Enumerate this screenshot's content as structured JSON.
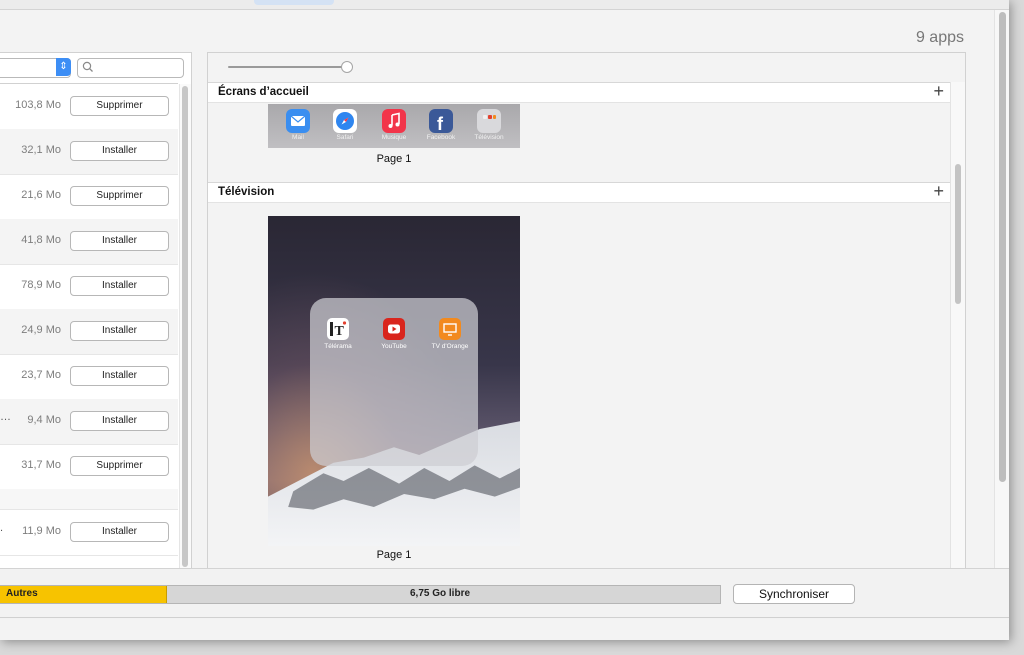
{
  "header": {
    "app_count": "9 apps"
  },
  "search": {
    "placeholder": ""
  },
  "apps_list": [
    {
      "size": "103,8 Mo",
      "action": "Supprimer",
      "prefix": ""
    },
    {
      "size": "32,1 Mo",
      "action": "Installer",
      "prefix": ""
    },
    {
      "size": "21,6 Mo",
      "action": "Supprimer",
      "prefix": ""
    },
    {
      "size": "41,8 Mo",
      "action": "Installer",
      "prefix": ""
    },
    {
      "size": "78,9 Mo",
      "action": "Installer",
      "prefix": ""
    },
    {
      "size": "24,9 Mo",
      "action": "Installer",
      "prefix": ""
    },
    {
      "size": "23,7 Mo",
      "action": "Installer",
      "prefix": ""
    },
    {
      "size": "9,4 Mo",
      "action": "Installer",
      "prefix": "…"
    },
    {
      "size": "31,7 Mo",
      "action": "Supprimer",
      "prefix": ""
    },
    {
      "size": "11,9 Mo",
      "action": "Installer",
      "prefix": "."
    }
  ],
  "home_screens": {
    "title": "Écrans d’accueil",
    "page_label": "Page 1",
    "dock_apps": [
      {
        "label": "Mail",
        "icon": "mail-icon",
        "color": "#3a8ef0"
      },
      {
        "label": "Safari",
        "icon": "safari-icon",
        "color": "#2f86f0"
      },
      {
        "label": "Musique",
        "icon": "music-icon",
        "color": "#f2354a"
      },
      {
        "label": "Facebook",
        "icon": "facebook-icon",
        "color": "#3b5998"
      },
      {
        "label": "Télévision",
        "icon": "folder-icon",
        "color": "#d9d9dc"
      }
    ]
  },
  "television": {
    "title": "Télévision",
    "page_label": "Page 1",
    "folder_apps": [
      {
        "label": "Télérama",
        "icon": "telerama-icon",
        "color": "#ffffff"
      },
      {
        "label": "YouTube",
        "icon": "youtube-icon",
        "color": "#d9251d"
      },
      {
        "label": "TV d'Orange",
        "icon": "orange-tv-icon",
        "color": "#f28a1e"
      }
    ]
  },
  "storage": {
    "others_label": "Autres",
    "free_label": "6,75 Go libre",
    "others_color": "#f7c300"
  },
  "actions": {
    "sync_label": "Synchroniser"
  }
}
